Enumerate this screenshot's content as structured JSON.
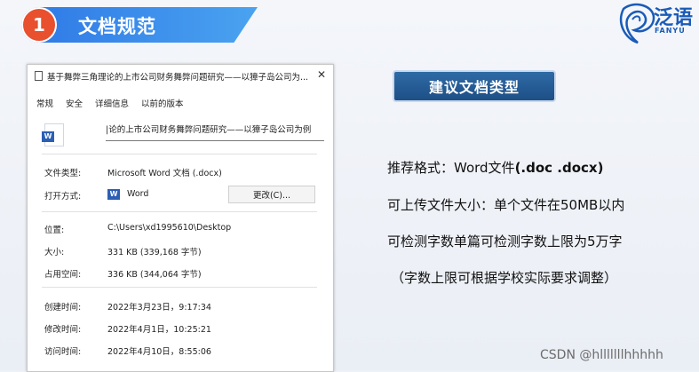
{
  "header": {
    "number": "1",
    "title": "文档规范",
    "brand_text": "泛语",
    "brand_sub": "FANYU"
  },
  "window": {
    "title": "基于舞弊三角理论的上市公司财务舞弊问题研究——以獐子岛公司为...",
    "tabs": [
      "常规",
      "安全",
      "详细信息",
      "以前的版本"
    ],
    "file_icon_letter": "W",
    "filename": "|论的上市公司财务舞弊问题研究——以獐子岛公司为例",
    "rows": {
      "file_type_label": "文件类型:",
      "file_type_value": "Microsoft Word 文档 (.docx)",
      "open_with_label": "打开方式:",
      "open_with_app": "Word",
      "change_button": "更改(C)...",
      "location_label": "位置:",
      "location_value": "C:\\Users\\xd1995610\\Desktop",
      "size_label": "大小:",
      "size_value": "331 KB (339,168 字节)",
      "disk_size_label": "占用空间:",
      "disk_size_value": "336 KB (344,064 字节)",
      "created_label": "创建时间:",
      "created_value": "2022年3月23日，9:17:34",
      "modified_label": "修改时间:",
      "modified_value": "2022年4月1日，10:25:21",
      "accessed_label": "访问时间:",
      "accessed_value": "2022年4月10日，8:55:06"
    }
  },
  "right": {
    "tag": "建议文档类型",
    "format_prefix": "推荐格式：Word文件",
    "format_ext": "(.doc .docx)",
    "upload_size": "可上传文件大小：单个文件在50MB以内",
    "word_limit": "可检测字数单篇可检测字数上限为5万字",
    "note": "（字数上限可根据学校实际要求调整）"
  },
  "watermark": "CSDN @hlllllllhhhhh",
  "colors": {
    "banner": "#2e78e6",
    "badge": "#e8502e",
    "tag": "#1d4f86",
    "word_blue": "#2b5fb4"
  }
}
